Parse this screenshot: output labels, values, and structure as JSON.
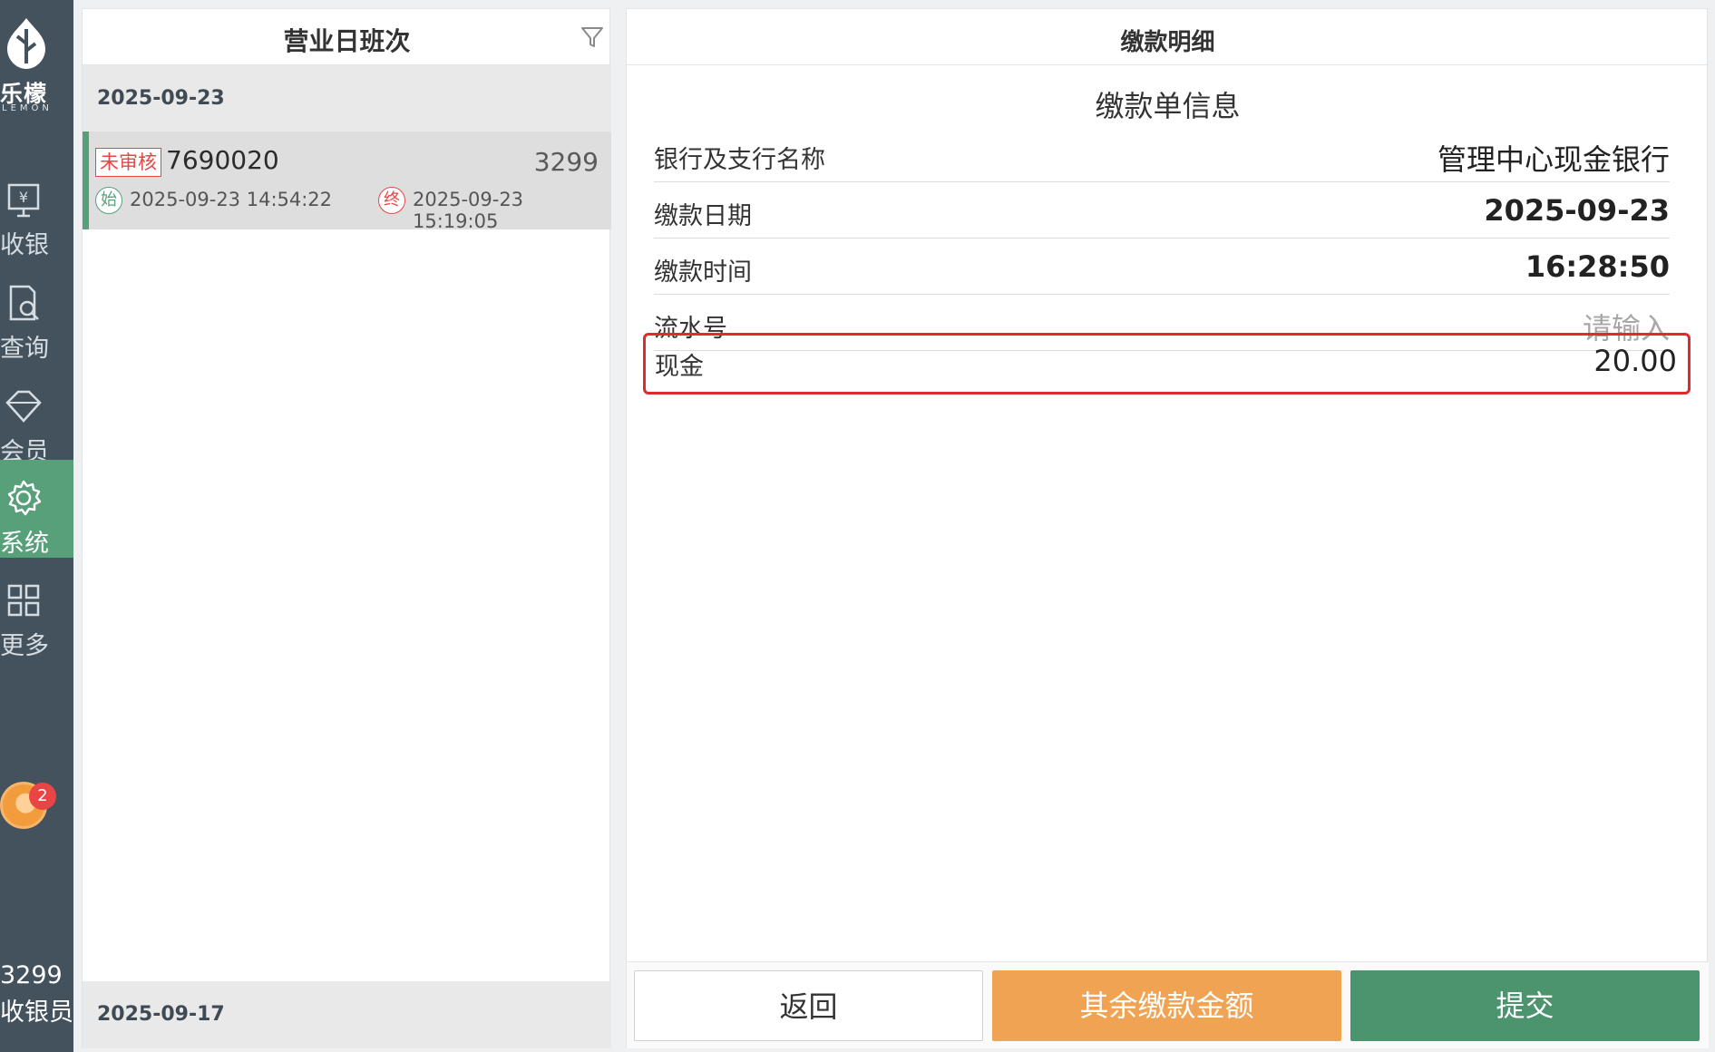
{
  "sidebar": {
    "logo_text": "乐檬",
    "logo_sub": "LEMON",
    "items": [
      {
        "label": "收银",
        "icon": "cashier-icon"
      },
      {
        "label": "查询",
        "icon": "search-doc-icon"
      },
      {
        "label": "会员",
        "icon": "diamond-icon"
      },
      {
        "label": "系统",
        "icon": "gear-icon",
        "active": true
      },
      {
        "label": "更多",
        "icon": "grid-icon"
      }
    ],
    "notification_count": "2",
    "user_id": "3299",
    "user_role": "收银员"
  },
  "left_panel": {
    "title": "营业日班次",
    "groups": [
      {
        "date": "2025-09-23",
        "shifts": [
          {
            "status": "未审核",
            "shift_no": "7690020",
            "cashier": "3299",
            "start_tag": "始",
            "start_time": "2025-09-23 14:54:22",
            "end_tag": "终",
            "end_time": "2025-09-23 15:19:05"
          }
        ]
      },
      {
        "date": "2025-09-17",
        "shifts": []
      }
    ]
  },
  "right_panel": {
    "title": "缴款明细",
    "section_title": "缴款单信息",
    "fields": [
      {
        "label": "银行及支行名称",
        "value": "管理中心现金银行"
      },
      {
        "label": "缴款日期",
        "value": "2025-09-23"
      },
      {
        "label": "缴款时间",
        "value": "16:28:50"
      },
      {
        "label": "流水号",
        "placeholder": "请输入"
      },
      {
        "label": "现金",
        "value": "20.00",
        "highlighted": true
      }
    ],
    "buttons": {
      "back": "返回",
      "other_amount": "其余缴款金额",
      "submit": "提交"
    }
  },
  "colors": {
    "sidebar_bg": "#44525e",
    "active_green": "#58a07a",
    "submit_green": "#4b946e",
    "orange": "#f0a352",
    "highlight_red": "#e02b2b",
    "status_red": "#e94545"
  }
}
